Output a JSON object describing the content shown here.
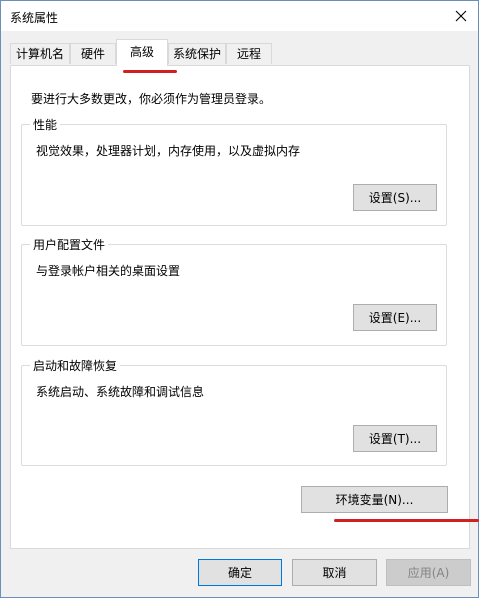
{
  "window": {
    "title": "系统属性"
  },
  "tabs": [
    {
      "label": "计算机名"
    },
    {
      "label": "硬件"
    },
    {
      "label": "高级"
    },
    {
      "label": "系统保护"
    },
    {
      "label": "远程"
    }
  ],
  "panel": {
    "admin_note": "要进行大多数更改，你必须作为管理员登录。",
    "performance": {
      "label": "性能",
      "description": "视觉效果，处理器计划，内存使用，以及虚拟内存",
      "button": "设置(S)..."
    },
    "user_profiles": {
      "label": "用户配置文件",
      "description": "与登录帐户相关的桌面设置",
      "button": "设置(E)..."
    },
    "startup_recovery": {
      "label": "启动和故障恢复",
      "description": "系统启动、系统故障和调试信息",
      "button": "设置(T)..."
    },
    "env_button": "环境变量(N)..."
  },
  "footer": {
    "ok": "确定",
    "cancel": "取消",
    "apply": "应用(A)"
  },
  "colors": {
    "accent": "#0078d7",
    "annotation": "#d21f1f",
    "window_border": "#6b8fb9"
  }
}
